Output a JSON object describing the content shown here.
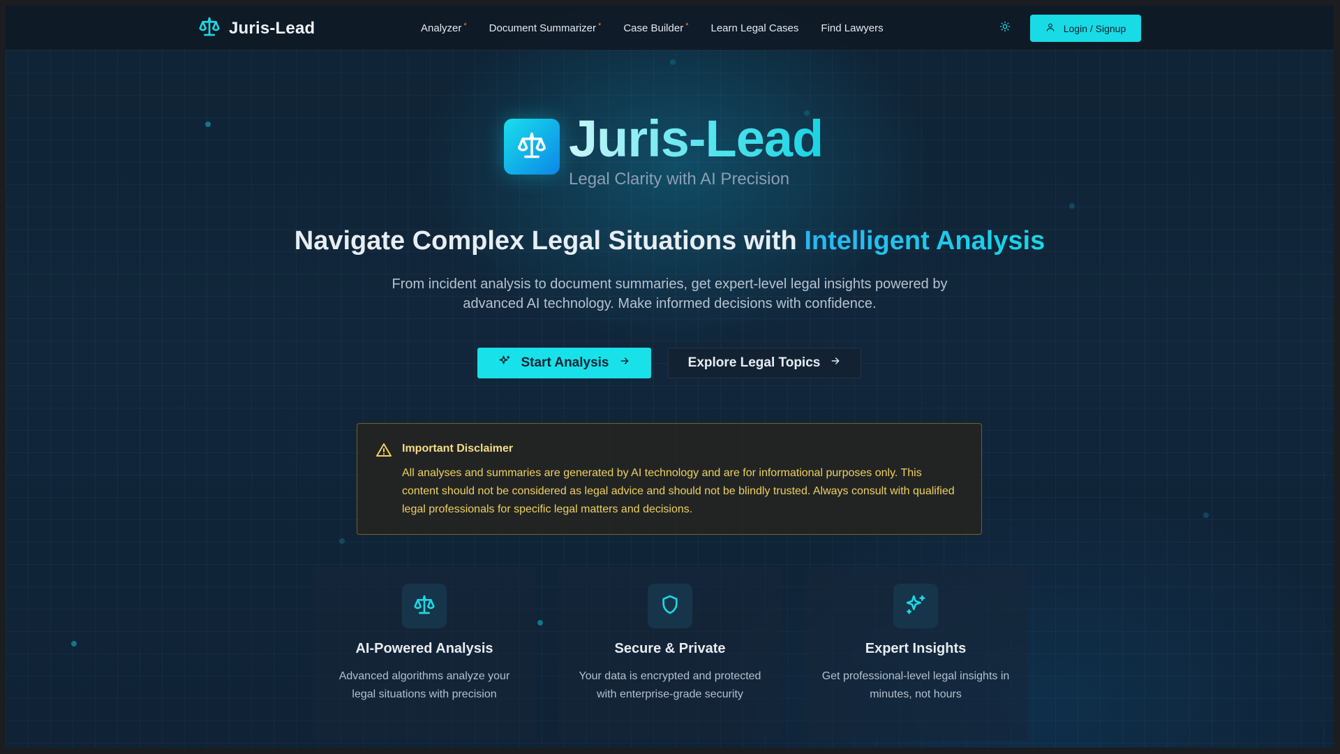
{
  "app": {
    "brand_name": "Juris-Lead"
  },
  "nav": {
    "links": [
      {
        "label": "Analyzer",
        "marker": "*"
      },
      {
        "label": "Document Summarizer",
        "marker": "*"
      },
      {
        "label": "Case Builder",
        "marker": "*"
      },
      {
        "label": "Learn Legal Cases"
      },
      {
        "label": "Find Lawyers"
      }
    ],
    "theme_icon": "sun-icon",
    "login_label": "Login / Signup",
    "login_icon": "user-icon"
  },
  "hero": {
    "title": "Juris-Lead",
    "tagline": "Legal Clarity with AI Precision",
    "headline_prefix": "Navigate Complex Legal Situations with ",
    "headline_accent": "Intelligent Analysis",
    "subtext": "From incident analysis to document summaries, get expert-level legal insights powered by advanced AI technology. Make informed decisions with confidence.",
    "primary_button": "Start Analysis",
    "secondary_button": "Explore Legal Topics"
  },
  "disclaimer": {
    "title": "Important Disclaimer",
    "body": "All analyses and summaries are generated by AI technology and are for informational purposes only. This content should not be considered as legal advice and should not be blindly trusted. Always consult with qualified legal professionals for specific legal matters and decisions."
  },
  "features": [
    {
      "icon": "scales-icon",
      "title": "AI-Powered Analysis",
      "description": "Advanced algorithms analyze your legal situations with precision"
    },
    {
      "icon": "shield-icon",
      "title": "Secure & Private",
      "description": "Your data is encrypted and protected with enterprise-grade security"
    },
    {
      "icon": "sparkles-icon",
      "title": "Expert Insights",
      "description": "Get professional-level legal insights in minutes, not hours"
    }
  ],
  "colors": {
    "accent": "#19e1ea",
    "accent_blue": "#2ab6f0",
    "warning": "#eed15e",
    "background": "#10243a"
  }
}
